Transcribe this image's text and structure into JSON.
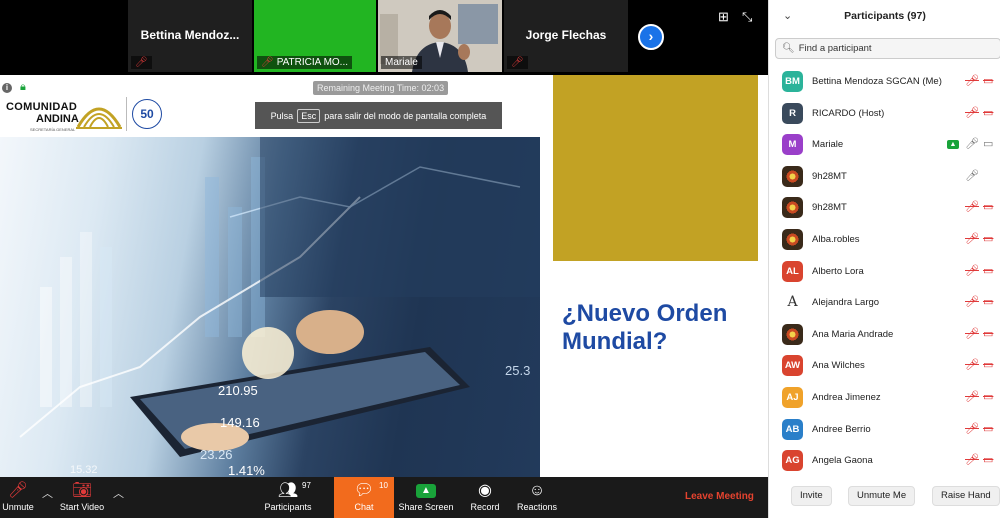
{
  "video_strip": {
    "tiles": [
      {
        "name": "Bettina  Mendoz...",
        "bg": "#1f1f1f"
      },
      {
        "name": "PATRICIA MO...",
        "bg": "#22b522"
      },
      {
        "name": "Mariale",
        "bg": "#c9c4bb"
      },
      {
        "name": "Jorge Flechas",
        "bg": "#1f1f1f"
      }
    ],
    "next_symbol": "›"
  },
  "shared_screen": {
    "remaining_time": "Remaining Meeting Time: 02:03",
    "esc_banner": {
      "before": "Pulsa",
      "key": "Esc",
      "after": "para salir del modo de pantalla completa"
    },
    "logo": {
      "line1": "COMUNIDAD",
      "line2": "ANDINA",
      "subtitle": "SECRETARÍA GENERAL",
      "anniversary": "50"
    },
    "photo_values": [
      "210.95",
      "149.16",
      "23.26",
      "1.41%",
      "25.3",
      "15.32"
    ],
    "title": "¿Nuevo Orden Mundial?",
    "colors": {
      "gold": "#c2a224",
      "title_blue": "#1e4aa3"
    }
  },
  "toolbar": {
    "unmute": "Unmute",
    "start_video": "Start Video",
    "participants": "Participants",
    "participants_count": "97",
    "chat": "Chat",
    "chat_count": "10",
    "share_screen": "Share Screen",
    "record": "Record",
    "reactions": "Reactions",
    "leave": "Leave Meeting"
  },
  "participants_panel": {
    "title": "Participants (97)",
    "search_placeholder": "Find a participant",
    "participants": [
      {
        "name": "Bettina Mendoza SGCAN (Me)",
        "initials": "BM",
        "color": "#2bb39a",
        "mic": "off",
        "video": "off"
      },
      {
        "name": "RICARDO (Host)",
        "initials": "R",
        "color": "#3a4a5c",
        "mic": "off",
        "video": "off"
      },
      {
        "name": "Mariale",
        "initials": "M",
        "color": "#9a3fc9",
        "mic": "on",
        "video": "on",
        "sharing": true
      },
      {
        "name": "9h28MT",
        "initials": "",
        "color": "#3a2a1a",
        "mic": "on",
        "video": "none"
      },
      {
        "name": "9h28MT",
        "initials": "",
        "color": "#3a2a1a",
        "mic": "off",
        "video": "off"
      },
      {
        "name": "Alba.robles",
        "initials": "",
        "color": "#222222",
        "mic": "off",
        "video": "off"
      },
      {
        "name": "Alberto Lora",
        "initials": "AL",
        "color": "#d9442f",
        "mic": "off",
        "video": "off"
      },
      {
        "name": "Alejandra Largo",
        "initials": "A",
        "color": "#ffffff",
        "mic": "off",
        "video": "off"
      },
      {
        "name": "Ana Maria Andrade",
        "initials": "",
        "color": "#8a6a4e",
        "mic": "off",
        "video": "off"
      },
      {
        "name": "Ana Wilches",
        "initials": "AW",
        "color": "#d9442f",
        "mic": "off",
        "video": "off"
      },
      {
        "name": "Andrea Jimenez",
        "initials": "AJ",
        "color": "#f0a22a",
        "mic": "off",
        "video": "off"
      },
      {
        "name": "Andree Berrio",
        "initials": "AB",
        "color": "#2a7fc9",
        "mic": "off",
        "video": "off"
      },
      {
        "name": "Angela Gaona",
        "initials": "AG",
        "color": "#d9442f",
        "mic": "off",
        "video": "off"
      }
    ],
    "footer": {
      "invite": "Invite",
      "unmute_me": "Unmute Me",
      "raise_hand": "Raise Hand"
    }
  }
}
